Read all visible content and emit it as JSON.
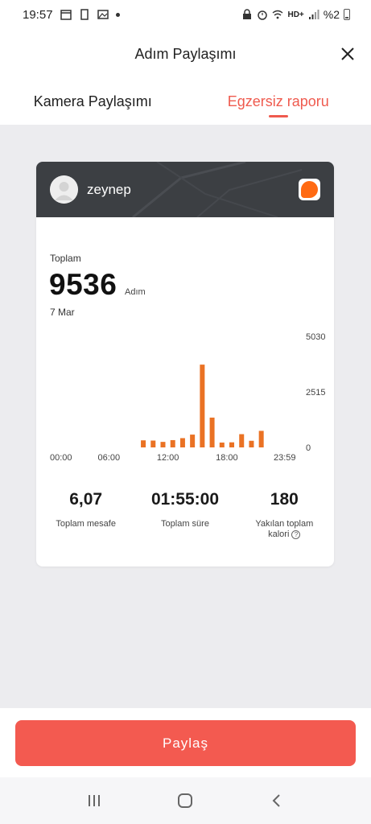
{
  "status_bar": {
    "time": "19:57",
    "battery_text": "%2",
    "network": "HD+"
  },
  "header": {
    "title": "Adım Paylaşımı"
  },
  "tabs": [
    {
      "label": "Kamera Paylaşımı",
      "active": false
    },
    {
      "label": "Egzersiz raporu",
      "active": true
    }
  ],
  "card": {
    "username": "zeynep",
    "total_label": "Toplam",
    "total_value": "9536",
    "total_unit": "Adım",
    "date": "7 Mar",
    "stats": [
      {
        "value": "6,07",
        "label": "Toplam mesafe"
      },
      {
        "value": "01:55:00",
        "label": "Toplam süre"
      },
      {
        "value": "180",
        "label": "Yakılan toplam kalori"
      }
    ]
  },
  "chart_data": {
    "type": "bar",
    "x_tick_labels": [
      "00:00",
      "06:00",
      "12:00",
      "18:00",
      "23:59"
    ],
    "y_tick_labels": [
      "5030",
      "2515",
      "0"
    ],
    "ylim": [
      0,
      5030
    ],
    "x": [
      "09:00",
      "10:00",
      "11:00",
      "12:00",
      "13:00",
      "14:00",
      "15:00",
      "16:00",
      "17:00",
      "18:00",
      "19:00",
      "20:00",
      "21:00",
      "22:00"
    ],
    "values": [
      320,
      310,
      250,
      330,
      420,
      580,
      3750,
      1350,
      220,
      230,
      600,
      300,
      750,
      0
    ],
    "bar_color": "#ea7224"
  },
  "share_button": {
    "label": "Paylaş"
  },
  "colors": {
    "accent": "#ef5a4e",
    "share_button": "#f35a50",
    "card_header": "#3c3f43",
    "content_bg": "#ececef"
  },
  "icons": {
    "close": "close-icon",
    "nav_recent": "recent-apps-icon",
    "nav_home": "home-icon",
    "nav_back": "back-icon"
  }
}
